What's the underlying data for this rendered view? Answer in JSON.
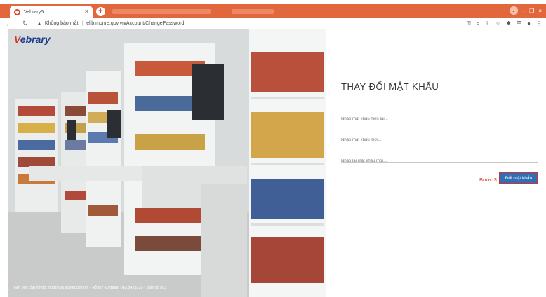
{
  "browser": {
    "tab_title": "Vebrary5",
    "tab_close": "×",
    "new_tab": "+",
    "window_controls": [
      "–",
      "❐",
      "×"
    ],
    "address": {
      "security_text": "Không bảo mật",
      "url": "elib.monre.gov.vn/Account/ChangePassword"
    }
  },
  "brand": {
    "logo_prefix": "V",
    "logo_rest": "ebrary"
  },
  "footer": {
    "support_text": "Gửi yêu cầu hỗ trợ: hotrotv@lacviet.com.vn - Hỗ trợ Kỹ thuật: 083.8423333 - bấm số 503"
  },
  "form": {
    "title": "THAY ĐỔI MẬT KHẨU",
    "current_password_placeholder": "Nhập mật khẩu hiện tại...",
    "new_password_placeholder": "Nhập mật khẩu mới...",
    "confirm_password_placeholder": "Nhập lại mật khẩu mới...",
    "step_label": "Bước 3",
    "submit_label": "Đổi mật khẩu"
  }
}
